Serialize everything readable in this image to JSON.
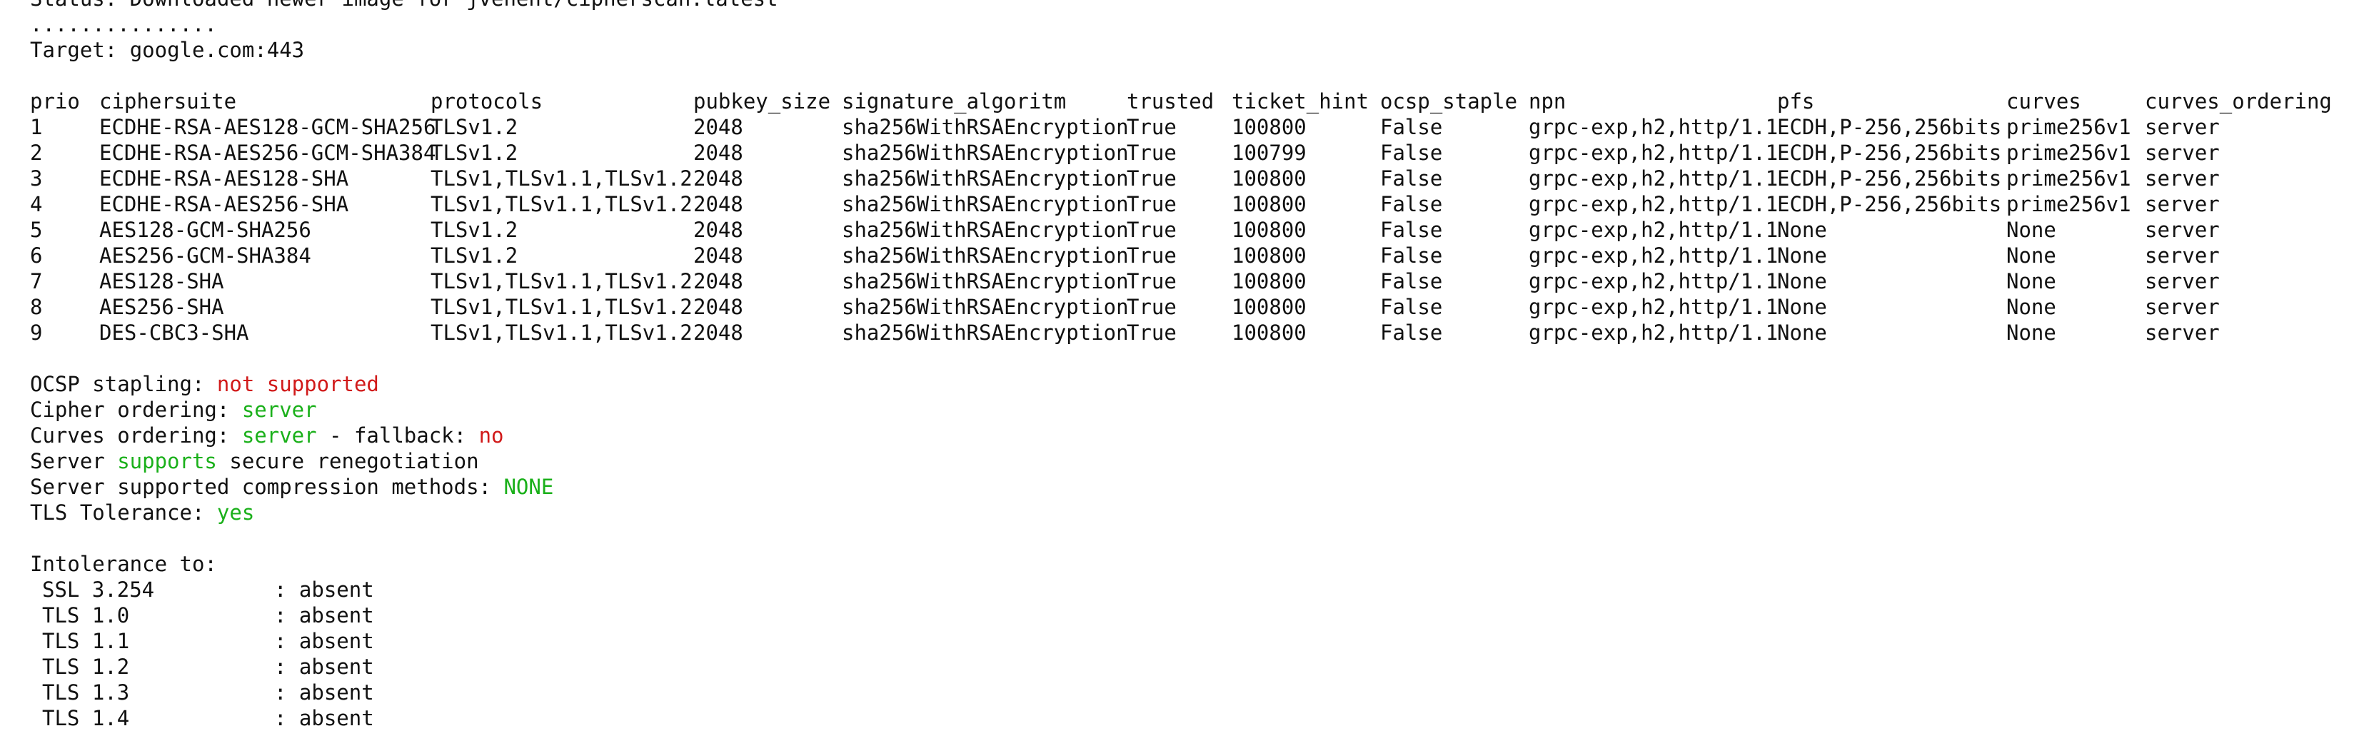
{
  "header": {
    "status_line": "Status: Downloaded newer image for jvehent/cipherscan:latest",
    "dots": "...............",
    "target_label": "Target:",
    "target_value": "google.com:443"
  },
  "table": {
    "columns": [
      "prio",
      "ciphersuite",
      "protocols",
      "pubkey_size",
      "signature_algoritm",
      "trusted",
      "ticket_hint",
      "ocsp_staple",
      "npn",
      "pfs",
      "curves",
      "curves_ordering"
    ],
    "rows": [
      [
        "1",
        "ECDHE-RSA-AES128-GCM-SHA256",
        "TLSv1.2",
        "2048",
        "sha256WithRSAEncryption",
        "True",
        "100800",
        "False",
        "grpc-exp,h2,http/1.1",
        "ECDH,P-256,256bits",
        "prime256v1",
        "server"
      ],
      [
        "2",
        "ECDHE-RSA-AES256-GCM-SHA384",
        "TLSv1.2",
        "2048",
        "sha256WithRSAEncryption",
        "True",
        "100799",
        "False",
        "grpc-exp,h2,http/1.1",
        "ECDH,P-256,256bits",
        "prime256v1",
        "server"
      ],
      [
        "3",
        "ECDHE-RSA-AES128-SHA",
        "TLSv1,TLSv1.1,TLSv1.2",
        "2048",
        "sha256WithRSAEncryption",
        "True",
        "100800",
        "False",
        "grpc-exp,h2,http/1.1",
        "ECDH,P-256,256bits",
        "prime256v1",
        "server"
      ],
      [
        "4",
        "ECDHE-RSA-AES256-SHA",
        "TLSv1,TLSv1.1,TLSv1.2",
        "2048",
        "sha256WithRSAEncryption",
        "True",
        "100800",
        "False",
        "grpc-exp,h2,http/1.1",
        "ECDH,P-256,256bits",
        "prime256v1",
        "server"
      ],
      [
        "5",
        "AES128-GCM-SHA256",
        "TLSv1.2",
        "2048",
        "sha256WithRSAEncryption",
        "True",
        "100800",
        "False",
        "grpc-exp,h2,http/1.1",
        "None",
        "None",
        "server"
      ],
      [
        "6",
        "AES256-GCM-SHA384",
        "TLSv1.2",
        "2048",
        "sha256WithRSAEncryption",
        "True",
        "100800",
        "False",
        "grpc-exp,h2,http/1.1",
        "None",
        "None",
        "server"
      ],
      [
        "7",
        "AES128-SHA",
        "TLSv1,TLSv1.1,TLSv1.2",
        "2048",
        "sha256WithRSAEncryption",
        "True",
        "100800",
        "False",
        "grpc-exp,h2,http/1.1",
        "None",
        "None",
        "server"
      ],
      [
        "8",
        "AES256-SHA",
        "TLSv1,TLSv1.1,TLSv1.2",
        "2048",
        "sha256WithRSAEncryption",
        "True",
        "100800",
        "False",
        "grpc-exp,h2,http/1.1",
        "None",
        "None",
        "server"
      ],
      [
        "9",
        "DES-CBC3-SHA",
        "TLSv1,TLSv1.1,TLSv1.2",
        "2048",
        "sha256WithRSAEncryption",
        "True",
        "100800",
        "False",
        "grpc-exp,h2,http/1.1",
        "None",
        "None",
        "server"
      ]
    ]
  },
  "summary": {
    "ocsp_label": "OCSP stapling: ",
    "ocsp_value": "not supported",
    "cipher_label": "Cipher ordering: ",
    "cipher_value": "server",
    "curves_label": "Curves ordering: ",
    "curves_value": "server",
    "curves_mid": " - fallback: ",
    "curves_fallback": "no",
    "reneg_prefix": "Server ",
    "reneg_value": "supports",
    "reneg_suffix": " secure renegotiation",
    "compression_label": "Server supported compression methods: ",
    "compression_value": "NONE",
    "tolerance_label": "TLS Tolerance: ",
    "tolerance_value": "yes"
  },
  "intolerance": {
    "heading": "Intolerance to:",
    "separator": ": ",
    "items": [
      {
        "name": "SSL 3.254",
        "status": "absent"
      },
      {
        "name": "TLS 1.0",
        "status": "absent"
      },
      {
        "name": "TLS 1.1",
        "status": "absent"
      },
      {
        "name": "TLS 1.2",
        "status": "absent"
      },
      {
        "name": "TLS 1.3",
        "status": "absent"
      },
      {
        "name": "TLS 1.4",
        "status": "absent"
      }
    ]
  },
  "colors": {
    "negative": "#d11a1a",
    "positive": "#1ab01a",
    "text": "#111111",
    "background": "#ffffff"
  }
}
